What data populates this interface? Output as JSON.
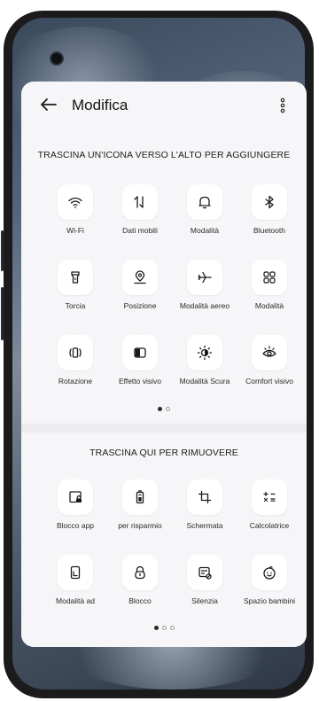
{
  "header": {
    "title": "Modifica"
  },
  "add_section": {
    "title": "TRASCINA UN'ICONA VERSO L'ALTO PER AGGIUNGERE",
    "tiles": [
      {
        "label": "Wi-Fi",
        "icon": "wifi-icon"
      },
      {
        "label": "Dati mobili",
        "icon": "mobile-data-icon"
      },
      {
        "label": "Modalità",
        "icon": "bell-icon"
      },
      {
        "label": "Bluetooth",
        "icon": "bluetooth-icon"
      },
      {
        "label": "Torcia",
        "icon": "flashlight-icon"
      },
      {
        "label": "Posizione",
        "icon": "location-icon"
      },
      {
        "label": "Modalità aereo",
        "icon": "airplane-icon"
      },
      {
        "label": "Modalità",
        "icon": "grid-icon"
      },
      {
        "label": "Rotazione",
        "icon": "rotation-icon"
      },
      {
        "label": "Effetto visivo",
        "icon": "visual-effect-icon"
      },
      {
        "label": "Modalità Scura",
        "icon": "dark-mode-icon"
      },
      {
        "label": "Comfort visivo",
        "icon": "eye-icon"
      }
    ],
    "page_dots": {
      "active": 1,
      "total": 2
    }
  },
  "remove_section": {
    "title": "TRASCINA QUI PER RIMUOVERE",
    "tiles": [
      {
        "label": "Blocco app",
        "icon": "app-lock-icon"
      },
      {
        "label": "per risparmio",
        "icon": "battery-saver-icon"
      },
      {
        "label": "Schermata",
        "icon": "crop-icon"
      },
      {
        "label": "Calcolatrice",
        "icon": "calculator-icon"
      },
      {
        "label": "Modalità ad",
        "icon": "one-hand-mode-icon"
      },
      {
        "label": "Blocco",
        "icon": "lock-icon"
      },
      {
        "label": "Silenzia",
        "icon": "silence-icon"
      },
      {
        "label": "Spazio bambini",
        "icon": "kids-space-icon"
      }
    ],
    "page_dots": {
      "active": 1,
      "total": 3
    }
  },
  "colors": {
    "panel_bg": "#f6f6f8",
    "tile_bg": "#ffffff",
    "text": "#1c1c1c"
  }
}
